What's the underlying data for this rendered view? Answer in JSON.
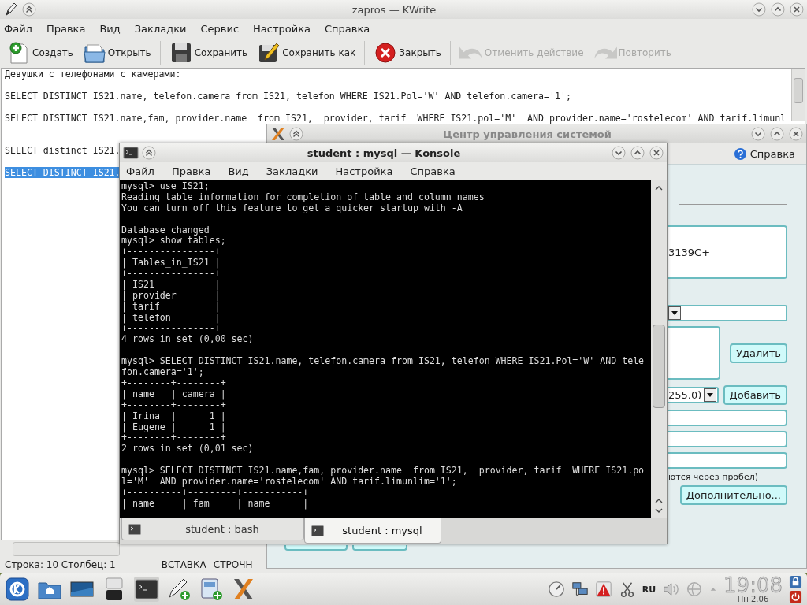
{
  "kwrite": {
    "title": "zapros — KWrite",
    "menu": [
      "Файл",
      "Правка",
      "Вид",
      "Закладки",
      "Сервис",
      "Настройка",
      "Справка"
    ],
    "toolbar": [
      [
        {
          "kind": "new",
          "label": "Создать",
          "disabled": false
        },
        {
          "kind": "open",
          "label": "Открыть",
          "disabled": false
        }
      ],
      [
        {
          "kind": "save",
          "label": "Сохранить",
          "disabled": false
        },
        {
          "kind": "save_as",
          "label": "Сохранить как",
          "disabled": false
        }
      ],
      [
        {
          "kind": "close",
          "label": "Закрыть",
          "disabled": false
        }
      ],
      [
        {
          "kind": "undo",
          "label": "Отменить действие",
          "disabled": true
        },
        {
          "kind": "redo",
          "label": "Повторить",
          "disabled": true
        }
      ]
    ],
    "lines": [
      {
        "kind": "text",
        "text": "Девушки с телефонами с камерами:",
        "selected": false
      },
      {
        "kind": "blank"
      },
      {
        "kind": "text",
        "text": "SELECT DISTINCT IS21.name, telefon.camera from IS21, telefon WHERE IS21.Pol='W' AND telefon.camera='1';",
        "selected": false
      },
      {
        "kind": "blank"
      },
      {
        "kind": "text",
        "text": "SELECT DISTINCT IS21.name,fam, provider.name  from IS21,  provider, tarif  WHERE IS21.pol='M'  AND provider.name='rostelecom' AND tarif.limunl",
        "selected": false
      },
      {
        "kind": "blank"
      },
      {
        "kind": "blank"
      },
      {
        "kind": "text",
        "text": "SELECT distinct IS21.",
        "selected": false
      },
      {
        "kind": "blank"
      },
      {
        "kind": "text",
        "text": "SELECT DISTINCT IS21.",
        "selected": true
      }
    ],
    "status": {
      "position": "Строка: 10 Столбец: 1",
      "mode": "ВСТАВКА",
      "case": "СТРОЧН"
    }
  },
  "control_center": {
    "title": "Центр управления системой",
    "help": "Справка",
    "address_fragment": "3139C+",
    "combo_value": "255.0)",
    "delete_button": "Удалить",
    "add_button": "Добавить",
    "hint": "ются через пробел)",
    "more_button": "Дополнительно..."
  },
  "konsole": {
    "title": "student : mysql — Konsole",
    "menu": [
      "Файл",
      "Правка",
      "Вид",
      "Закладки",
      "Настройка",
      "Справка"
    ],
    "lines": [
      {
        "kind": "text",
        "text": "mysql> use IS21;"
      },
      {
        "kind": "text",
        "text": "Reading table information for completion of table and column names"
      },
      {
        "kind": "text",
        "text": "You can turn off this feature to get a quicker startup with -A"
      },
      {
        "kind": "blank"
      },
      {
        "kind": "text",
        "text": "Database changed"
      },
      {
        "kind": "text",
        "text": "mysql> show tables;"
      },
      {
        "kind": "text",
        "text": "+----------------+"
      },
      {
        "kind": "text",
        "text": "| Tables_in_IS21 |"
      },
      {
        "kind": "text",
        "text": "+----------------+"
      },
      {
        "kind": "text",
        "text": "| IS21           |"
      },
      {
        "kind": "text",
        "text": "| provider       |"
      },
      {
        "kind": "text",
        "text": "| tarif          |"
      },
      {
        "kind": "text",
        "text": "| telefon        |"
      },
      {
        "kind": "text",
        "text": "+----------------+"
      },
      {
        "kind": "text",
        "text": "4 rows in set (0,00 sec)"
      },
      {
        "kind": "blank"
      },
      {
        "kind": "text",
        "text": "mysql> SELECT DISTINCT IS21.name, telefon.camera from IS21, telefon WHERE IS21.Pol='W' AND tele"
      },
      {
        "kind": "text",
        "text": "fon.camera='1';"
      },
      {
        "kind": "text",
        "text": "+--------+--------+"
      },
      {
        "kind": "text",
        "text": "| name   | camera |"
      },
      {
        "kind": "text",
        "text": "+--------+--------+"
      },
      {
        "kind": "text",
        "text": "| Irina  |      1 |"
      },
      {
        "kind": "text",
        "text": "| Eugene |      1 |"
      },
      {
        "kind": "text",
        "text": "+--------+--------+"
      },
      {
        "kind": "text",
        "text": "2 rows in set (0,01 sec)"
      },
      {
        "kind": "blank"
      },
      {
        "kind": "text",
        "text": "mysql> SELECT DISTINCT IS21.name,fam, provider.name  from IS21,  provider, tarif  WHERE IS21.po"
      },
      {
        "kind": "text",
        "text": "l='M'  AND provider.name='rostelecom' AND tarif.limunlim='1';"
      },
      {
        "kind": "text",
        "text": "+----------+---------+-----------+"
      },
      {
        "kind": "text",
        "text": "| name     | fam     | name      |"
      }
    ],
    "tabs": [
      {
        "label": "student : bash",
        "selected": false
      },
      {
        "label": "student : mysql",
        "selected": true
      }
    ]
  },
  "taskbar": {
    "language": "RU",
    "time": "19:08",
    "date": "Пн 2.06"
  }
}
